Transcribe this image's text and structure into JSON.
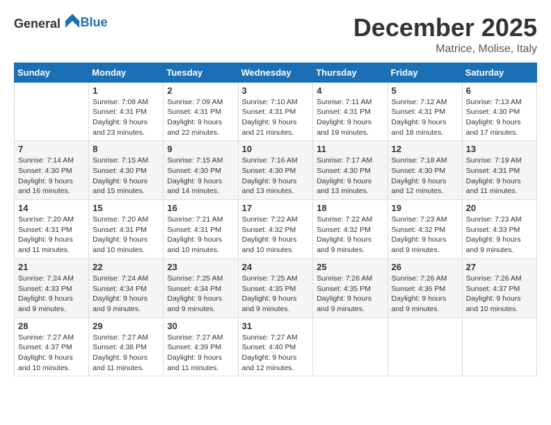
{
  "header": {
    "logo": {
      "general": "General",
      "blue": "Blue"
    },
    "title": "December 2025",
    "location": "Matrice, Molise, Italy"
  },
  "columns": [
    "Sunday",
    "Monday",
    "Tuesday",
    "Wednesday",
    "Thursday",
    "Friday",
    "Saturday"
  ],
  "weeks": [
    [
      {
        "day": "",
        "sunrise": "",
        "sunset": "",
        "daylight": ""
      },
      {
        "day": "1",
        "sunrise": "Sunrise: 7:08 AM",
        "sunset": "Sunset: 4:31 PM",
        "daylight": "Daylight: 9 hours and 23 minutes."
      },
      {
        "day": "2",
        "sunrise": "Sunrise: 7:09 AM",
        "sunset": "Sunset: 4:31 PM",
        "daylight": "Daylight: 9 hours and 22 minutes."
      },
      {
        "day": "3",
        "sunrise": "Sunrise: 7:10 AM",
        "sunset": "Sunset: 4:31 PM",
        "daylight": "Daylight: 9 hours and 21 minutes."
      },
      {
        "day": "4",
        "sunrise": "Sunrise: 7:11 AM",
        "sunset": "Sunset: 4:31 PM",
        "daylight": "Daylight: 9 hours and 19 minutes."
      },
      {
        "day": "5",
        "sunrise": "Sunrise: 7:12 AM",
        "sunset": "Sunset: 4:31 PM",
        "daylight": "Daylight: 9 hours and 18 minutes."
      },
      {
        "day": "6",
        "sunrise": "Sunrise: 7:13 AM",
        "sunset": "Sunset: 4:30 PM",
        "daylight": "Daylight: 9 hours and 17 minutes."
      }
    ],
    [
      {
        "day": "7",
        "sunrise": "Sunrise: 7:14 AM",
        "sunset": "Sunset: 4:30 PM",
        "daylight": "Daylight: 9 hours and 16 minutes."
      },
      {
        "day": "8",
        "sunrise": "Sunrise: 7:15 AM",
        "sunset": "Sunset: 4:30 PM",
        "daylight": "Daylight: 9 hours and 15 minutes."
      },
      {
        "day": "9",
        "sunrise": "Sunrise: 7:15 AM",
        "sunset": "Sunset: 4:30 PM",
        "daylight": "Daylight: 9 hours and 14 minutes."
      },
      {
        "day": "10",
        "sunrise": "Sunrise: 7:16 AM",
        "sunset": "Sunset: 4:30 PM",
        "daylight": "Daylight: 9 hours and 13 minutes."
      },
      {
        "day": "11",
        "sunrise": "Sunrise: 7:17 AM",
        "sunset": "Sunset: 4:30 PM",
        "daylight": "Daylight: 9 hours and 13 minutes."
      },
      {
        "day": "12",
        "sunrise": "Sunrise: 7:18 AM",
        "sunset": "Sunset: 4:30 PM",
        "daylight": "Daylight: 9 hours and 12 minutes."
      },
      {
        "day": "13",
        "sunrise": "Sunrise: 7:19 AM",
        "sunset": "Sunset: 4:31 PM",
        "daylight": "Daylight: 9 hours and 11 minutes."
      }
    ],
    [
      {
        "day": "14",
        "sunrise": "Sunrise: 7:20 AM",
        "sunset": "Sunset: 4:31 PM",
        "daylight": "Daylight: 9 hours and 11 minutes."
      },
      {
        "day": "15",
        "sunrise": "Sunrise: 7:20 AM",
        "sunset": "Sunset: 4:31 PM",
        "daylight": "Daylight: 9 hours and 10 minutes."
      },
      {
        "day": "16",
        "sunrise": "Sunrise: 7:21 AM",
        "sunset": "Sunset: 4:31 PM",
        "daylight": "Daylight: 9 hours and 10 minutes."
      },
      {
        "day": "17",
        "sunrise": "Sunrise: 7:22 AM",
        "sunset": "Sunset: 4:32 PM",
        "daylight": "Daylight: 9 hours and 10 minutes."
      },
      {
        "day": "18",
        "sunrise": "Sunrise: 7:22 AM",
        "sunset": "Sunset: 4:32 PM",
        "daylight": "Daylight: 9 hours and 9 minutes."
      },
      {
        "day": "19",
        "sunrise": "Sunrise: 7:23 AM",
        "sunset": "Sunset: 4:32 PM",
        "daylight": "Daylight: 9 hours and 9 minutes."
      },
      {
        "day": "20",
        "sunrise": "Sunrise: 7:23 AM",
        "sunset": "Sunset: 4:33 PM",
        "daylight": "Daylight: 9 hours and 9 minutes."
      }
    ],
    [
      {
        "day": "21",
        "sunrise": "Sunrise: 7:24 AM",
        "sunset": "Sunset: 4:33 PM",
        "daylight": "Daylight: 9 hours and 9 minutes."
      },
      {
        "day": "22",
        "sunrise": "Sunrise: 7:24 AM",
        "sunset": "Sunset: 4:34 PM",
        "daylight": "Daylight: 9 hours and 9 minutes."
      },
      {
        "day": "23",
        "sunrise": "Sunrise: 7:25 AM",
        "sunset": "Sunset: 4:34 PM",
        "daylight": "Daylight: 9 hours and 9 minutes."
      },
      {
        "day": "24",
        "sunrise": "Sunrise: 7:25 AM",
        "sunset": "Sunset: 4:35 PM",
        "daylight": "Daylight: 9 hours and 9 minutes."
      },
      {
        "day": "25",
        "sunrise": "Sunrise: 7:26 AM",
        "sunset": "Sunset: 4:35 PM",
        "daylight": "Daylight: 9 hours and 9 minutes."
      },
      {
        "day": "26",
        "sunrise": "Sunrise: 7:26 AM",
        "sunset": "Sunset: 4:36 PM",
        "daylight": "Daylight: 9 hours and 9 minutes."
      },
      {
        "day": "27",
        "sunrise": "Sunrise: 7:26 AM",
        "sunset": "Sunset: 4:37 PM",
        "daylight": "Daylight: 9 hours and 10 minutes."
      }
    ],
    [
      {
        "day": "28",
        "sunrise": "Sunrise: 7:27 AM",
        "sunset": "Sunset: 4:37 PM",
        "daylight": "Daylight: 9 hours and 10 minutes."
      },
      {
        "day": "29",
        "sunrise": "Sunrise: 7:27 AM",
        "sunset": "Sunset: 4:38 PM",
        "daylight": "Daylight: 9 hours and 11 minutes."
      },
      {
        "day": "30",
        "sunrise": "Sunrise: 7:27 AM",
        "sunset": "Sunset: 4:39 PM",
        "daylight": "Daylight: 9 hours and 11 minutes."
      },
      {
        "day": "31",
        "sunrise": "Sunrise: 7:27 AM",
        "sunset": "Sunset: 4:40 PM",
        "daylight": "Daylight: 9 hours and 12 minutes."
      },
      {
        "day": "",
        "sunrise": "",
        "sunset": "",
        "daylight": ""
      },
      {
        "day": "",
        "sunrise": "",
        "sunset": "",
        "daylight": ""
      },
      {
        "day": "",
        "sunrise": "",
        "sunset": "",
        "daylight": ""
      }
    ]
  ]
}
